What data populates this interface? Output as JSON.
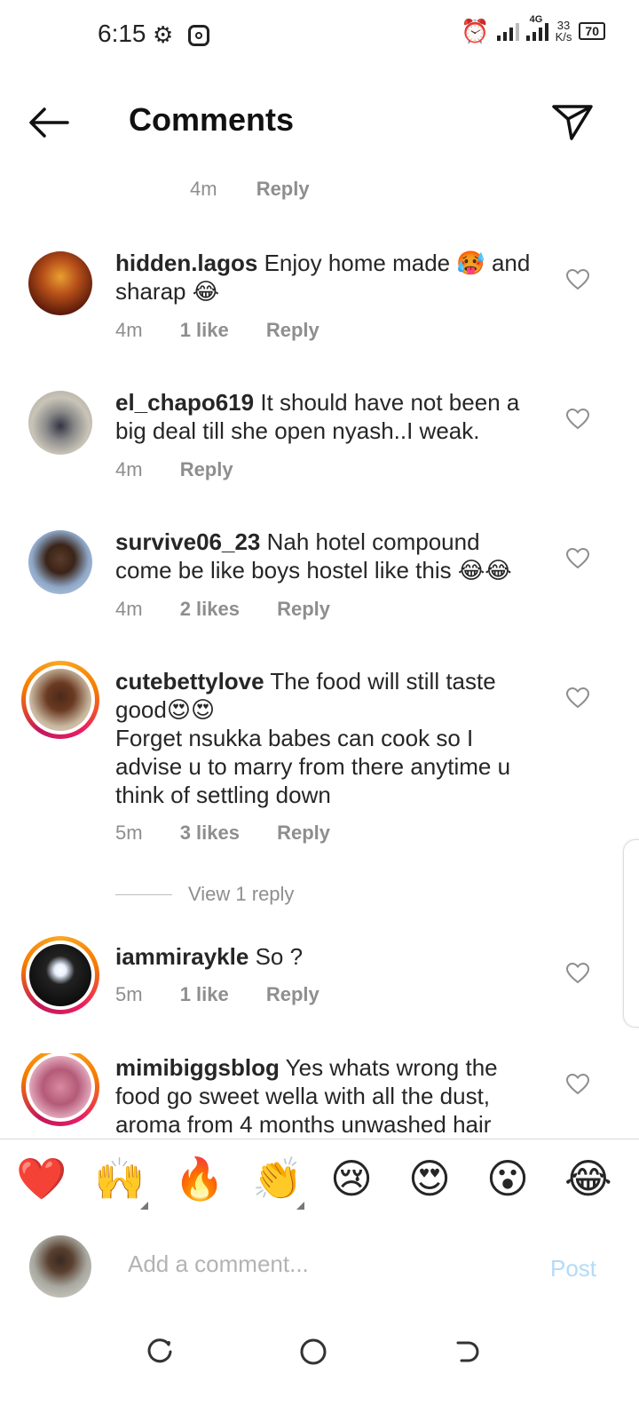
{
  "status_bar": {
    "time": "6:15",
    "network": "4G",
    "speed": "33",
    "speed_unit": "K/s",
    "battery": "70"
  },
  "header": {
    "title": "Comments"
  },
  "top_meta": {
    "time": "4m",
    "reply": "Reply"
  },
  "comments": [
    {
      "username": "hidden.lagos",
      "text": "Enjoy home made 🥵 and sharap 😂",
      "time": "4m",
      "likes": "1 like",
      "reply": "Reply"
    },
    {
      "username": "el_chapo619",
      "text": "It should have not been a big deal till she open nyash..I weak.",
      "time": "4m",
      "likes": "",
      "reply": "Reply"
    },
    {
      "username": "survive06_23",
      "text": "Nah hotel compound come be like boys hostel like this 😂😂",
      "time": "4m",
      "likes": "2 likes",
      "reply": "Reply"
    },
    {
      "username": "cutebettylove",
      "text": "The food will still taste good😍😍",
      "text2": "Forget nsukka babes can cook so I advise u to marry from there anytime u think of settling down",
      "time": "5m",
      "likes": "3 likes",
      "reply": "Reply"
    },
    {
      "username": "iammiraykle",
      "text": "So ?",
      "time": "5m",
      "likes": "1 like",
      "reply": "Reply"
    },
    {
      "username": "mimibiggsblog",
      "text": "Yes whats wrong the food go sweet wella with all the dust, aroma from 4 months unwashed hair"
    }
  ],
  "view_replies": "View 1 reply",
  "emoji_bar": [
    "❤️",
    "🙌",
    "🔥",
    "👏",
    "😢",
    "😍",
    "😮",
    "😂"
  ],
  "composer": {
    "placeholder": "Add a comment...",
    "post": "Post"
  },
  "colors": {
    "post_disabled": "#b3dbf9",
    "meta_gray": "#8e8e8e",
    "story_ring": "#e91e63"
  }
}
